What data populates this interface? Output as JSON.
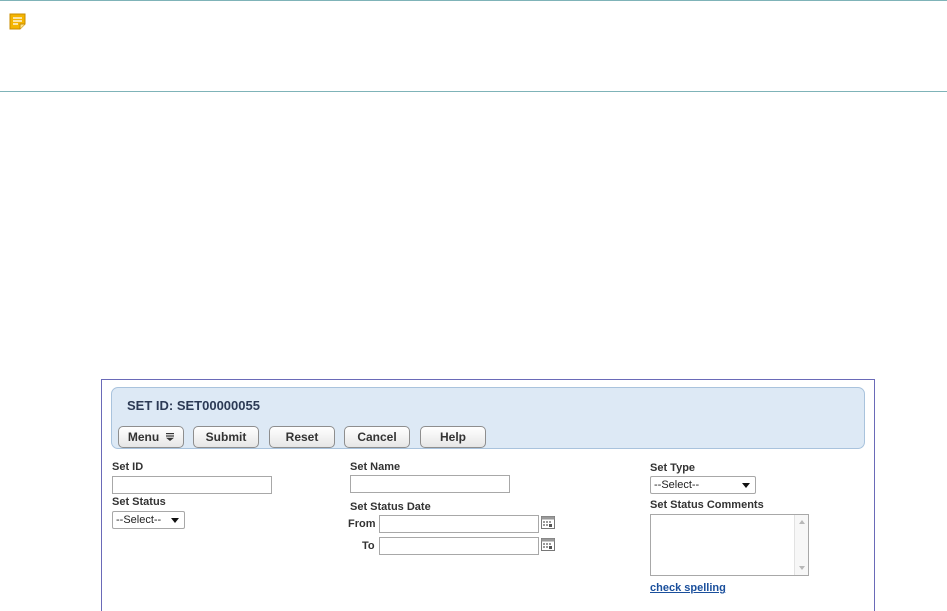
{
  "note": {
    "icon": "note-icon",
    "icon_color": "#f4b400"
  },
  "header": {
    "title": "SET ID: SET00000055",
    "buttons": {
      "menu": "Menu",
      "submit": "Submit",
      "reset": "Reset",
      "cancel": "Cancel",
      "help": "Help"
    }
  },
  "form": {
    "set_id": {
      "label": "Set ID",
      "value": ""
    },
    "set_status": {
      "label": "Set Status",
      "selected": "--Select--"
    },
    "set_name": {
      "label": "Set Name",
      "value": ""
    },
    "set_status_date": {
      "label": "Set Status Date",
      "from_label": "From",
      "from_value": "",
      "to_label": "To",
      "to_value": ""
    },
    "set_type": {
      "label": "Set Type",
      "selected": "--Select--"
    },
    "set_status_comments": {
      "label": "Set Status Comments",
      "value": ""
    },
    "check_spelling": "check spelling"
  },
  "colors": {
    "panel_border": "#6a6ab8",
    "header_bg": "#dde9f5",
    "link": "#1a4f9c",
    "band_border": "#7fb3b8"
  }
}
